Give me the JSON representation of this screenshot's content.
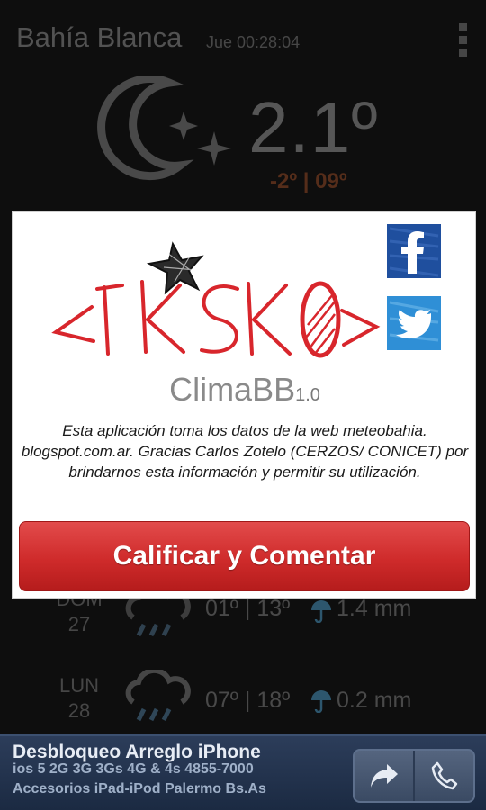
{
  "header": {
    "city": "Bahía Blanca",
    "time": "Jue 00:28:04",
    "menu_icon": "overflow-menu-icon"
  },
  "current": {
    "icon": "moon-stars-icon",
    "temperature": "2.1º",
    "min": "-2º",
    "max": "09º",
    "minmax_color": "#6e3a22"
  },
  "forecast": [
    {
      "day": "DOM",
      "date": "27",
      "icon": "rain-cloud-icon",
      "temps": "01º | 13º",
      "rain": "1.4 mm"
    },
    {
      "day": "LUN",
      "date": "28",
      "icon": "rain-cloud-icon",
      "temps": "07º | 18º",
      "rain": "0.2 mm"
    }
  ],
  "dialog": {
    "logo_text": "<IKSKO>",
    "facebook_icon": "facebook-icon",
    "twitter_icon": "twitter-icon",
    "app_name": "ClimaBB",
    "app_version": "1.0",
    "description": "Esta aplicación toma los datos de la web meteobahia. blogspot.com.ar. Gracias Carlos Zotelo (CERZOS/ CONICET) por brindarnos esta información y permitir su utilización.",
    "rate_button": "Calificar y Comentar",
    "button_color": "#cf2b2b"
  },
  "ad": {
    "title": "Desbloqueo Arreglo iPhone",
    "line1": "ios 5 2G 3G 3Gs 4G & 4s 4855-7000",
    "line2": "Accesorios iPad-iPod Palermo Bs.As",
    "share_icon": "share-arrow-icon",
    "call_icon": "phone-icon"
  }
}
